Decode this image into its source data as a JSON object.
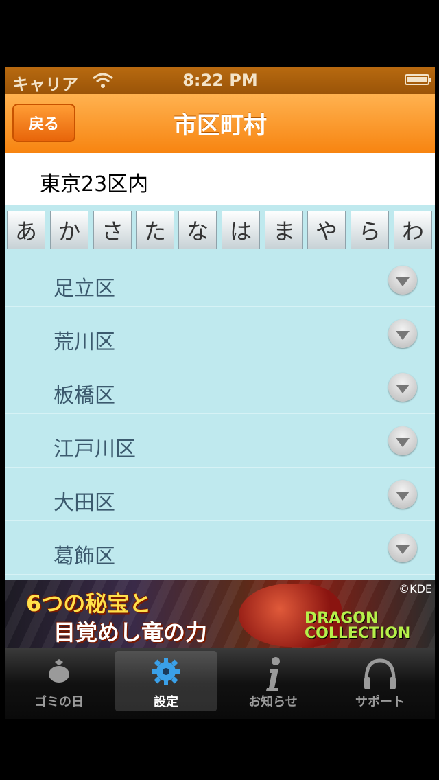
{
  "status_bar": {
    "carrier": "キャリア",
    "time": "8:22 PM"
  },
  "nav": {
    "back_label": "戻る",
    "title": "市区町村"
  },
  "section": {
    "header": "東京23区内"
  },
  "kana_index": [
    "あ",
    "か",
    "さ",
    "た",
    "な",
    "は",
    "ま",
    "や",
    "ら",
    "わ"
  ],
  "list_items": [
    {
      "label": "足立区"
    },
    {
      "label": "荒川区"
    },
    {
      "label": "板橋区"
    },
    {
      "label": "江戸川区"
    },
    {
      "label": "大田区"
    },
    {
      "label": "葛飾区"
    }
  ],
  "ad": {
    "line1": "6つの秘宝と",
    "line2": "目覚めし竜の力",
    "brand_line1": "DRAGON",
    "brand_line2": "COLLECTION",
    "copyright": "©KDE"
  },
  "tabs": [
    {
      "label": "ゴミの日",
      "icon": "garbage-bag-icon",
      "selected": false
    },
    {
      "label": "設定",
      "icon": "gear-icon",
      "selected": true
    },
    {
      "label": "お知らせ",
      "icon": "info-icon",
      "selected": false
    },
    {
      "label": "サポート",
      "icon": "headphones-icon",
      "selected": false
    }
  ],
  "colors": {
    "navbar": "#f78410",
    "statusbar": "#9a5408",
    "list_bg": "#bfe9ee",
    "row_text": "#3c5a6e"
  }
}
